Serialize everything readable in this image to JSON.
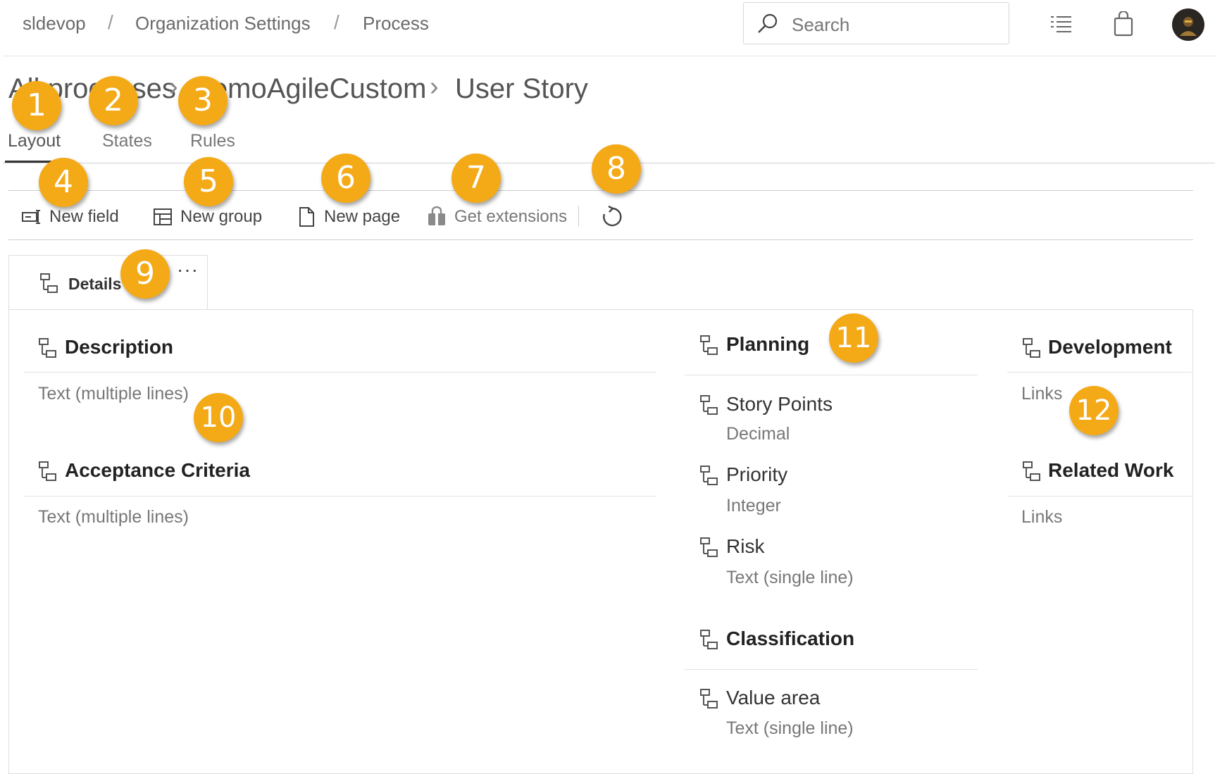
{
  "breadcrumb": [
    "sldevop",
    "Organization Settings",
    "Process"
  ],
  "search": {
    "placeholder": "Search"
  },
  "title_path": [
    "All processes",
    "DemoAgileCustom",
    "User Story"
  ],
  "tabs": [
    "Layout",
    "States",
    "Rules"
  ],
  "active_tab": "Layout",
  "toolbar": {
    "new_field": "New field",
    "new_group": "New group",
    "new_page": "New page",
    "get_extensions": "Get extensions"
  },
  "page": {
    "name": "Details",
    "more": "···"
  },
  "columns": {
    "left": [
      {
        "title": "Description",
        "fields": [
          {
            "type": "Text (multiple lines)"
          }
        ]
      },
      {
        "title": "Acceptance Criteria",
        "fields": [
          {
            "type": "Text (multiple lines)"
          }
        ]
      }
    ],
    "middle": [
      {
        "title": "Planning",
        "fields": [
          {
            "name": "Story Points",
            "type": "Decimal"
          },
          {
            "name": "Priority",
            "type": "Integer"
          },
          {
            "name": "Risk",
            "type": "Text (single line)"
          }
        ]
      },
      {
        "title": "Classification",
        "fields": [
          {
            "name": "Value area",
            "type": "Text (single line)"
          }
        ]
      }
    ],
    "right": [
      {
        "title": "Development",
        "fields": [
          {
            "type": "Links"
          }
        ]
      },
      {
        "title": "Related Work",
        "fields": [
          {
            "type": "Links"
          }
        ]
      }
    ]
  },
  "markers": [
    "1",
    "2",
    "3",
    "4",
    "5",
    "6",
    "7",
    "8",
    "9",
    "10",
    "11",
    "12"
  ],
  "colors": {
    "marker": "#f4a917",
    "accent": "#333333"
  }
}
